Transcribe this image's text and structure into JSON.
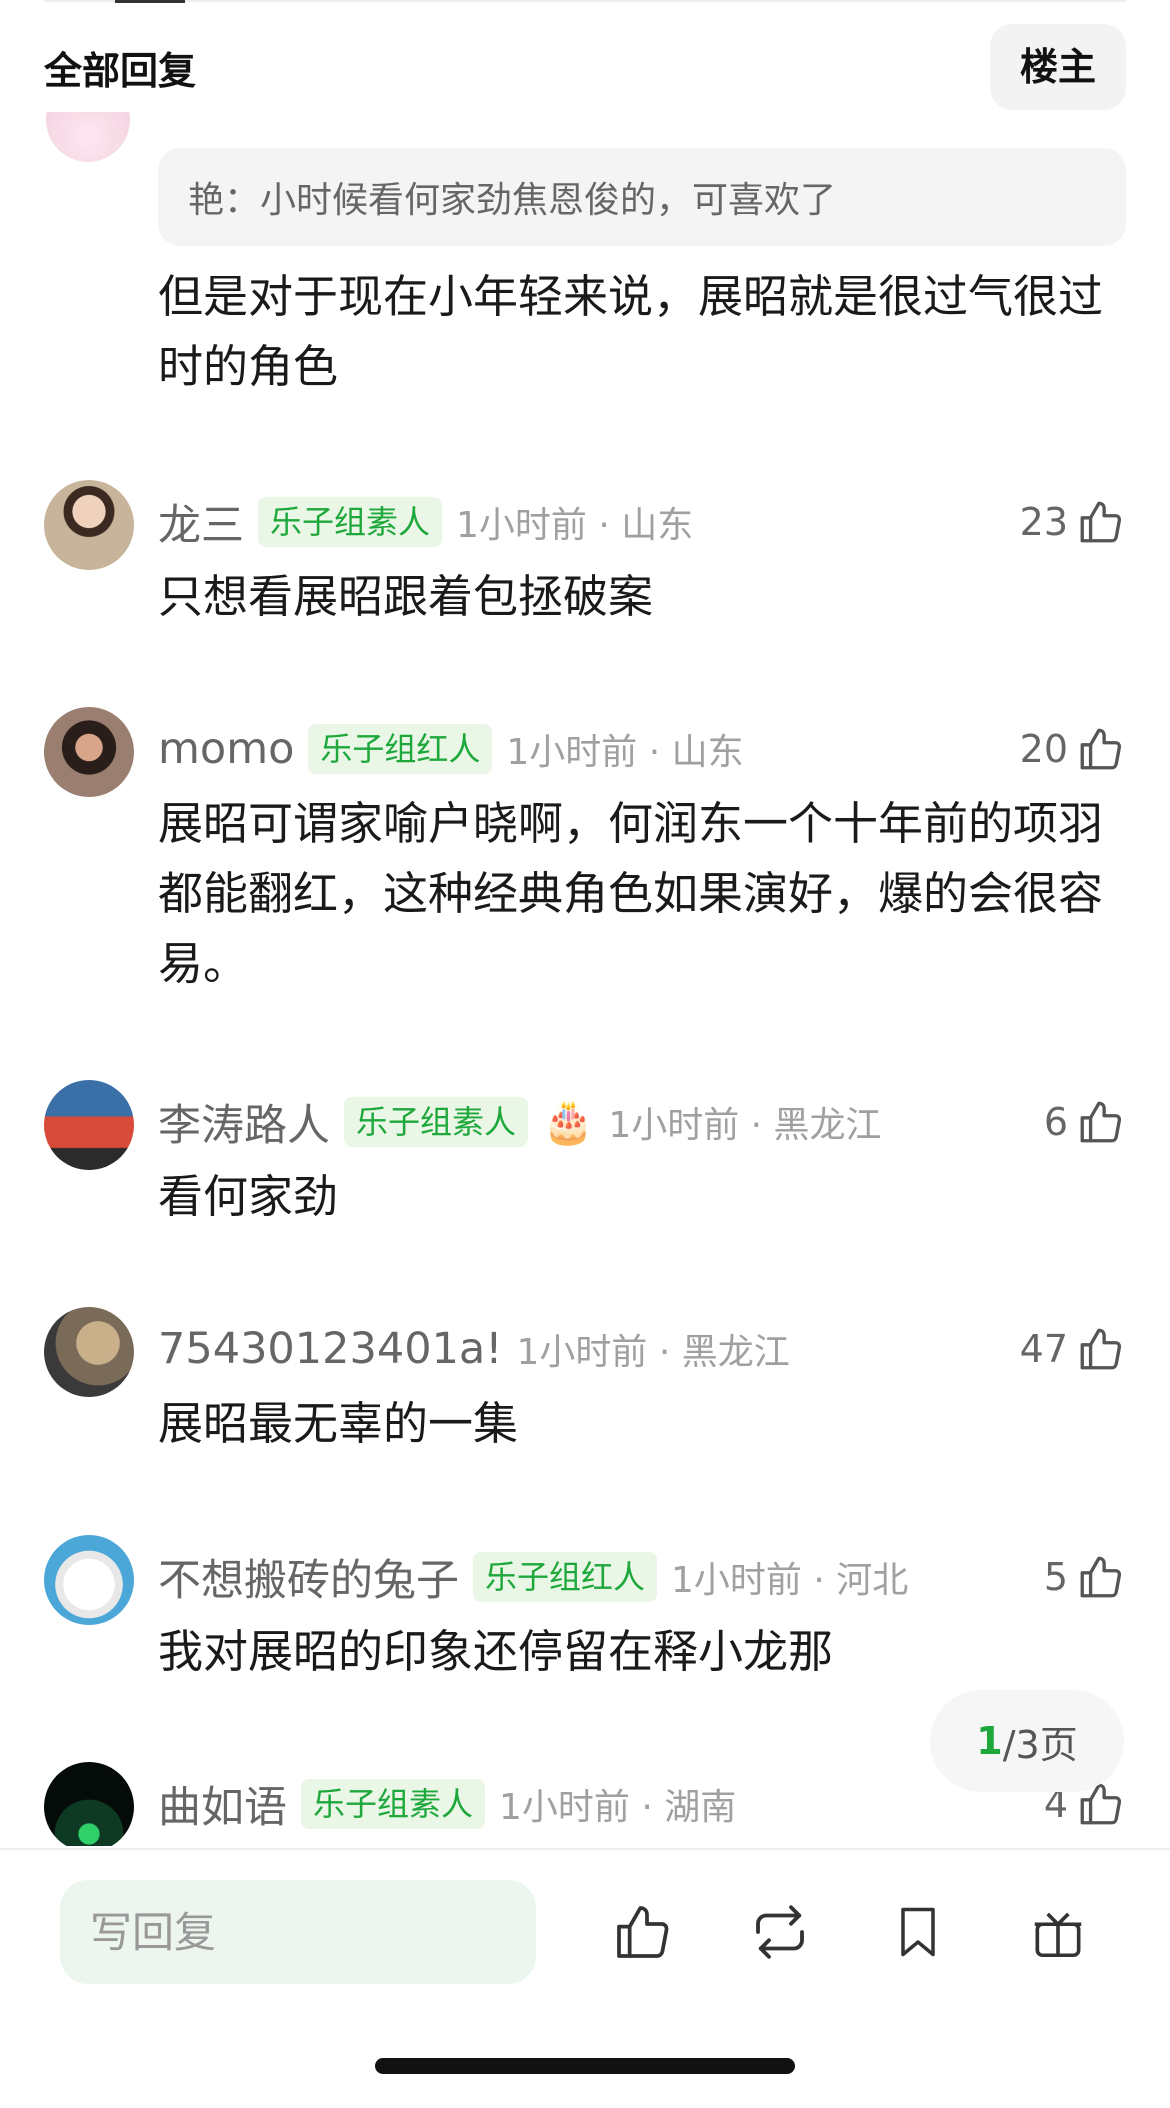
{
  "header": {
    "title": "全部回复",
    "op_button": "楼主"
  },
  "quoted": {
    "text": "艳：小时候看何家劲焦恩俊的，可喜欢了"
  },
  "reply": {
    "text": "但是对于现在小年轻来说，展昭就是很过气很过时的角色"
  },
  "comments": [
    {
      "user": "龙三",
      "badge": "乐子组素人",
      "emoji": "",
      "time": "1小时前 · 山东",
      "likes": "23",
      "text": "只想看展昭跟着包拯破案"
    },
    {
      "user": "momo",
      "badge": "乐子组红人",
      "emoji": "",
      "time": "1小时前 · 山东",
      "likes": "20",
      "text": "展昭可谓家喻户晓啊，何润东一个十年前的项羽都能翻红，这种经典角色如果演好，爆的会很容易。"
    },
    {
      "user": "李涛路人",
      "badge": "乐子组素人",
      "emoji": "🎂",
      "time": "1小时前 · 黑龙江",
      "likes": "6",
      "text": "看何家劲"
    },
    {
      "user": "75430123401a!",
      "badge": "",
      "emoji": "",
      "time": "1小时前 · 黑龙江",
      "likes": "47",
      "text": "展昭最无辜的一集"
    },
    {
      "user": "不想搬砖的兔子",
      "badge": "乐子组红人",
      "emoji": "",
      "time": "1小时前 · 河北",
      "likes": "5",
      "text": "我对展昭的印象还停留在释小龙那"
    },
    {
      "user": "曲如语",
      "badge": "乐子组素人",
      "emoji": "",
      "time": "1小时前 · 湖南",
      "likes": "4",
      "text": ""
    }
  ],
  "pager": {
    "current": "1",
    "total": "/3页"
  },
  "bottom": {
    "reply_placeholder": "写回复"
  },
  "colors": {
    "accent_green": "#1ea83c",
    "badge_bg": "#eaf6e6",
    "input_bg": "#edf6ee"
  },
  "icons": [
    "thumbs-up-icon",
    "repost-icon",
    "bookmark-icon",
    "gift-icon"
  ]
}
